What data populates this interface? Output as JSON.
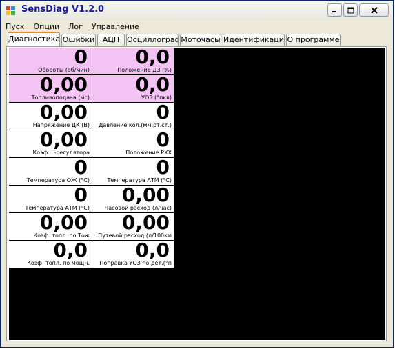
{
  "window": {
    "title": "SensDiag V1.2.0"
  },
  "menu": [
    "Пуск",
    "Опции",
    "Лог",
    "Управление"
  ],
  "tabs": [
    "Диагностика",
    "Ошибки",
    "АЦП",
    "Осциллограф",
    "Моточасы",
    "Идентификация",
    "О программе"
  ],
  "active_tab": "Диагностика",
  "colors": {
    "highlight": "#f3c4f3",
    "background": "#000000",
    "title_text": "#1a1a9a"
  },
  "cells": [
    {
      "value": "0",
      "label": "Обороты (об/мин)",
      "highlight": true
    },
    {
      "value": "0,0",
      "label": "Положение ДЗ (%)",
      "highlight": true
    },
    {
      "value": "0,00",
      "label": "Топливоподача (мс)",
      "highlight": true
    },
    {
      "value": "0,0",
      "label": "УОЗ (°пкв)",
      "highlight": true
    },
    {
      "value": "0,00",
      "label": "Напряжение ДК (В)",
      "highlight": false
    },
    {
      "value": "0",
      "label": "Давление кол.(мм.рт.ст.)",
      "highlight": false
    },
    {
      "value": "0,00",
      "label": "Коэф. L-регулятора",
      "highlight": false
    },
    {
      "value": "0",
      "label": "Положение РХХ",
      "highlight": false
    },
    {
      "value": "0",
      "label": "Температура ОЖ (°С)",
      "highlight": false
    },
    {
      "value": "0",
      "label": "Температура АТМ (°С)",
      "highlight": false
    },
    {
      "value": "0",
      "label": "Температура АТМ (°С)",
      "highlight": false
    },
    {
      "value": "0,00",
      "label": "Часовой расход (л/час)",
      "highlight": false
    },
    {
      "value": "0,00",
      "label": "Коэф. топл. по Тож",
      "highlight": false
    },
    {
      "value": "0,00",
      "label": "Путевой расход (л/100км",
      "highlight": false
    },
    {
      "value": "0,0",
      "label": "Коэф. топл. по мощн.",
      "highlight": false
    },
    {
      "value": "0,0",
      "label": "Поправка УОЗ по дет.(°п",
      "highlight": false
    }
  ]
}
